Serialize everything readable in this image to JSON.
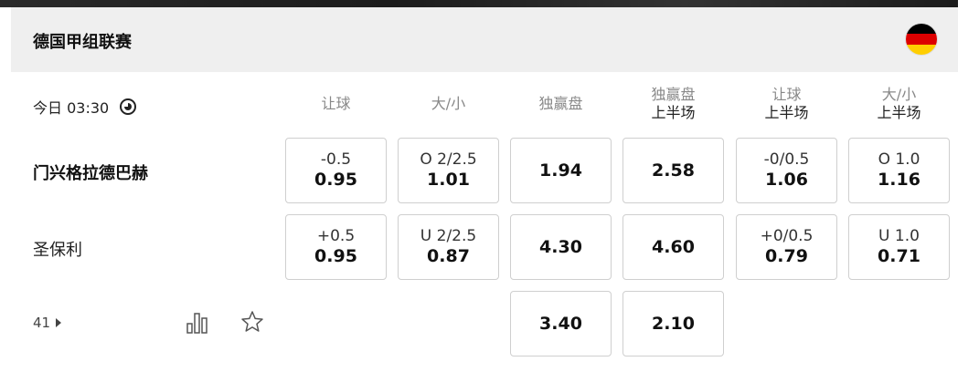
{
  "league": {
    "name": "德国甲组联赛",
    "flag_colors": [
      "#000000",
      "#dd0000",
      "#ffce00"
    ]
  },
  "match": {
    "time": "今日 03:30",
    "clock_icon": "clock-icon",
    "headers": [
      {
        "main": "让球",
        "sub": ""
      },
      {
        "main": "大/小",
        "sub": ""
      },
      {
        "main": "独赢盘",
        "sub": ""
      },
      {
        "main": "独赢盘",
        "sub": "上半场"
      },
      {
        "main": "让球",
        "sub": "上半场"
      },
      {
        "main": "大/小",
        "sub": "上半场"
      }
    ],
    "home": {
      "name": "门兴格拉德巴赫",
      "handicap": {
        "line": "-0.5",
        "odds": "0.95"
      },
      "over_under": {
        "line": "O 2/2.5",
        "odds": "1.01"
      },
      "moneyline": {
        "odds": "1.94"
      },
      "moneyline_1h": {
        "odds": "2.58"
      },
      "handicap_1h": {
        "line": "-0/0.5",
        "odds": "1.06"
      },
      "over_under_1h": {
        "line": "O 1.0",
        "odds": "1.16"
      }
    },
    "away": {
      "name": "圣保利",
      "handicap": {
        "line": "+0.5",
        "odds": "0.95"
      },
      "over_under": {
        "line": "U 2/2.5",
        "odds": "0.87"
      },
      "moneyline": {
        "odds": "4.30"
      },
      "moneyline_1h": {
        "odds": "4.60"
      },
      "handicap_1h": {
        "line": "+0/0.5",
        "odds": "0.79"
      },
      "over_under_1h": {
        "line": "U 1.0",
        "odds": "0.71"
      }
    },
    "draw": {
      "moneyline": {
        "odds": "3.40"
      },
      "moneyline_1h": {
        "odds": "2.10"
      }
    },
    "more_markets_count": "41",
    "icons": {
      "stats": "bar-chart-icon",
      "favorite": "star-icon"
    }
  }
}
